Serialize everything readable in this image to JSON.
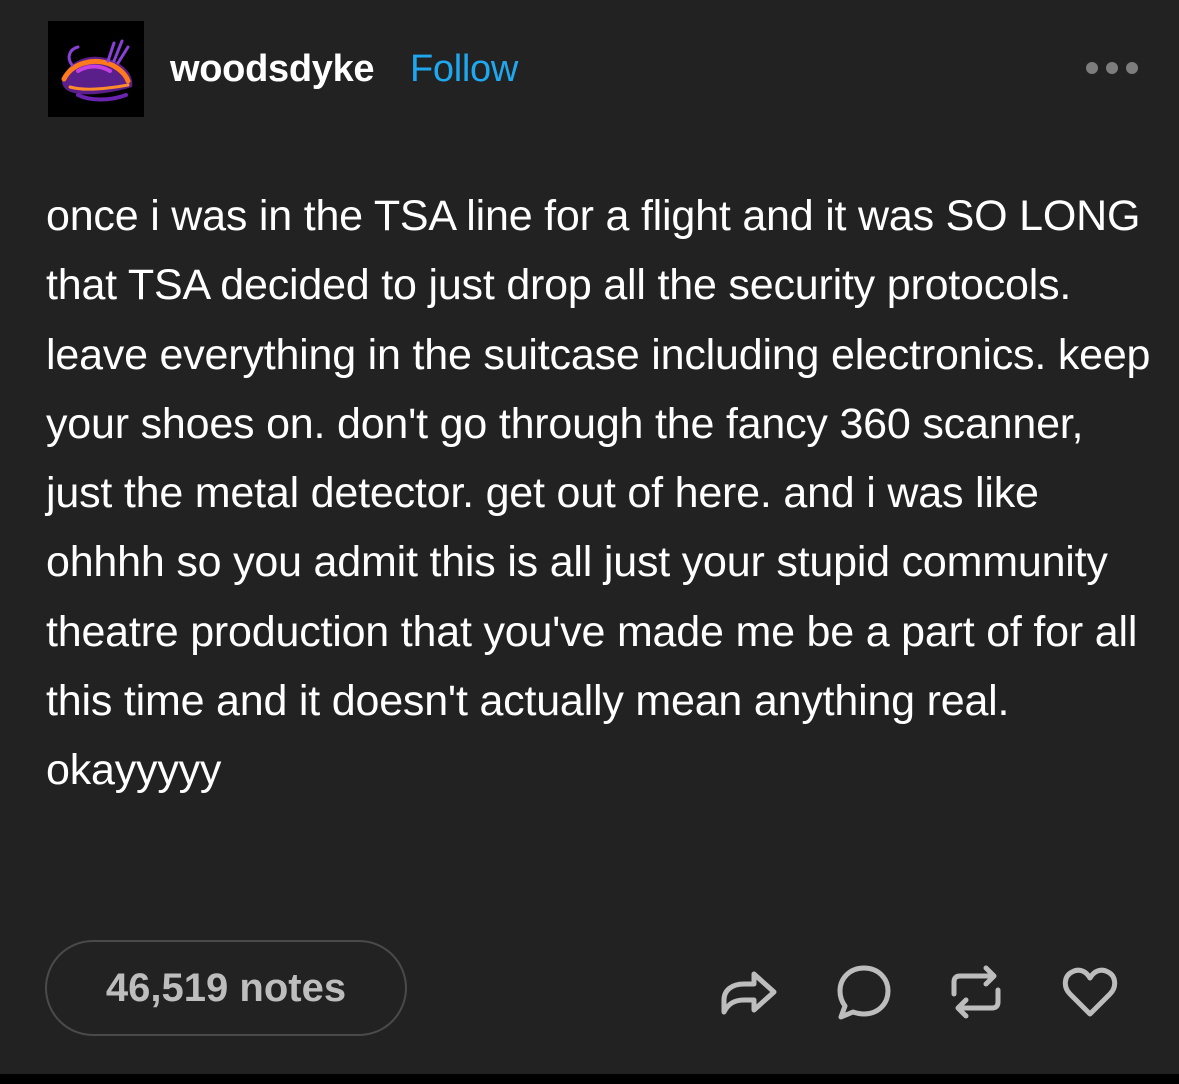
{
  "post": {
    "username": "woodsdyke",
    "follow_label": "Follow",
    "text": "once i was in the TSA line for a flight and it was SO LONG that TSA decided to just drop all the security protocols. leave everything in the suitcase including electronics. keep your shoes on. don't go through the fancy 360 scanner, just the metal detector. get out of here. and i was like ohhhh so you admit this is all just your stupid community theatre production that you've made me be a part of for all this time and it doesn't actually mean anything real. okayyyyy",
    "notes_label": "46,519 notes"
  },
  "icons": {
    "more": "more-options-icon",
    "share": "share-icon",
    "comment": "comment-icon",
    "reblog": "reblog-icon",
    "like": "heart-icon"
  },
  "colors": {
    "background": "#222222",
    "text": "#ffffff",
    "follow": "#1fa8f0",
    "icon": "#bdbdbd",
    "notes_border": "#4a4a4a"
  }
}
